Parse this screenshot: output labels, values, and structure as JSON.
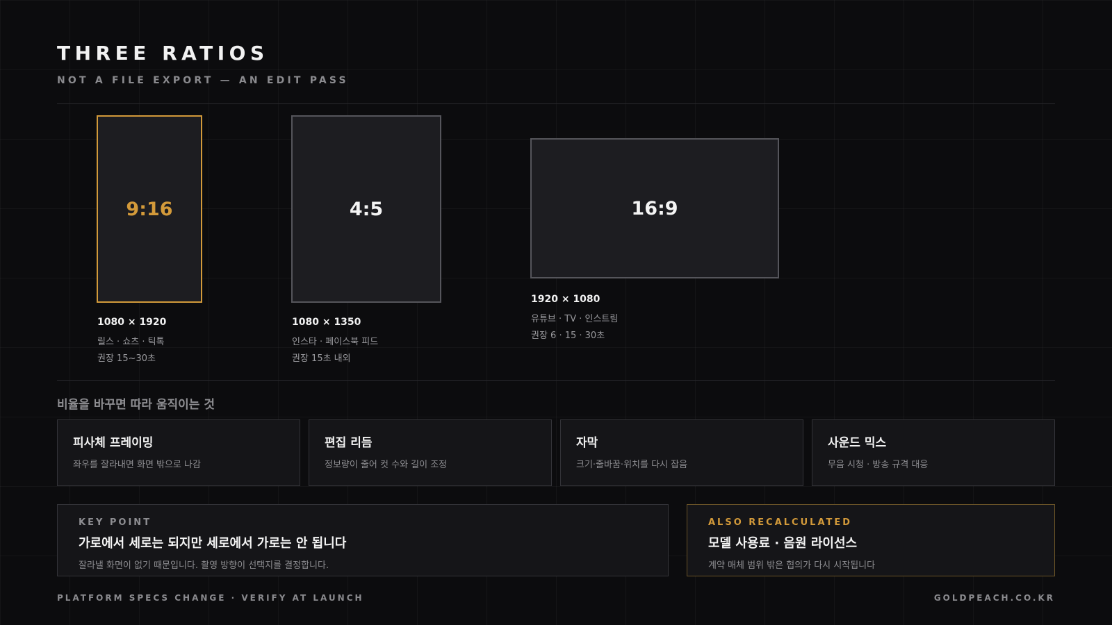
{
  "header": {
    "title": "THREE RATIOS",
    "subtitle": "NOT A FILE EXPORT — AN EDIT PASS"
  },
  "ratios": [
    {
      "label": "9:16",
      "resolution": "1080 × 1920",
      "platforms": "릴스 · 쇼츠 · 틱톡",
      "duration": "권장 15~30초",
      "highlighted": true
    },
    {
      "label": "4:5",
      "resolution": "1080 × 1350",
      "platforms": "인스타 · 페이스북 피드",
      "duration": "권장 15초 내외",
      "highlighted": false
    },
    {
      "label": "16:9",
      "resolution": "1920 × 1080",
      "platforms": "유튜브 · TV · 인스트림",
      "duration": "권장 6 · 15 · 30초",
      "highlighted": false
    }
  ],
  "changes": {
    "heading": "비율을 바꾸면 따라 움직이는 것",
    "items": [
      {
        "title": "피사체 프레이밍",
        "desc": "좌우를 잘라내면 화면 밖으로 나감"
      },
      {
        "title": "편집 리듬",
        "desc": "정보량이 줄어 컷 수와 길이 조정"
      },
      {
        "title": "자막",
        "desc": "크기·줄바꿈·위치를 다시 잡음"
      },
      {
        "title": "사운드 믹스",
        "desc": "무음 시청 · 방송 규격 대응"
      }
    ]
  },
  "key_point": {
    "eyebrow": "KEY POINT",
    "title": "가로에서 세로는 되지만 세로에서 가로는 안 됩니다",
    "desc": "잘라낼 화면이 없기 때문입니다. 촬영 방향이 선택지를 결정합니다."
  },
  "also_recalculated": {
    "eyebrow": "ALSO RECALCULATED",
    "title": "모델 사용료 · 음원 라이선스",
    "desc": "계약 매체 범위 밖은 협의가 다시 시작됩니다"
  },
  "footer": {
    "left": "PLATFORM SPECS CHANGE · VERIFY AT LAUNCH",
    "right": "GOLDPEACH.CO.KR"
  },
  "colors": {
    "background": "#0c0c0e",
    "accent": "#d39a3a",
    "frame_border": "#55555b"
  }
}
